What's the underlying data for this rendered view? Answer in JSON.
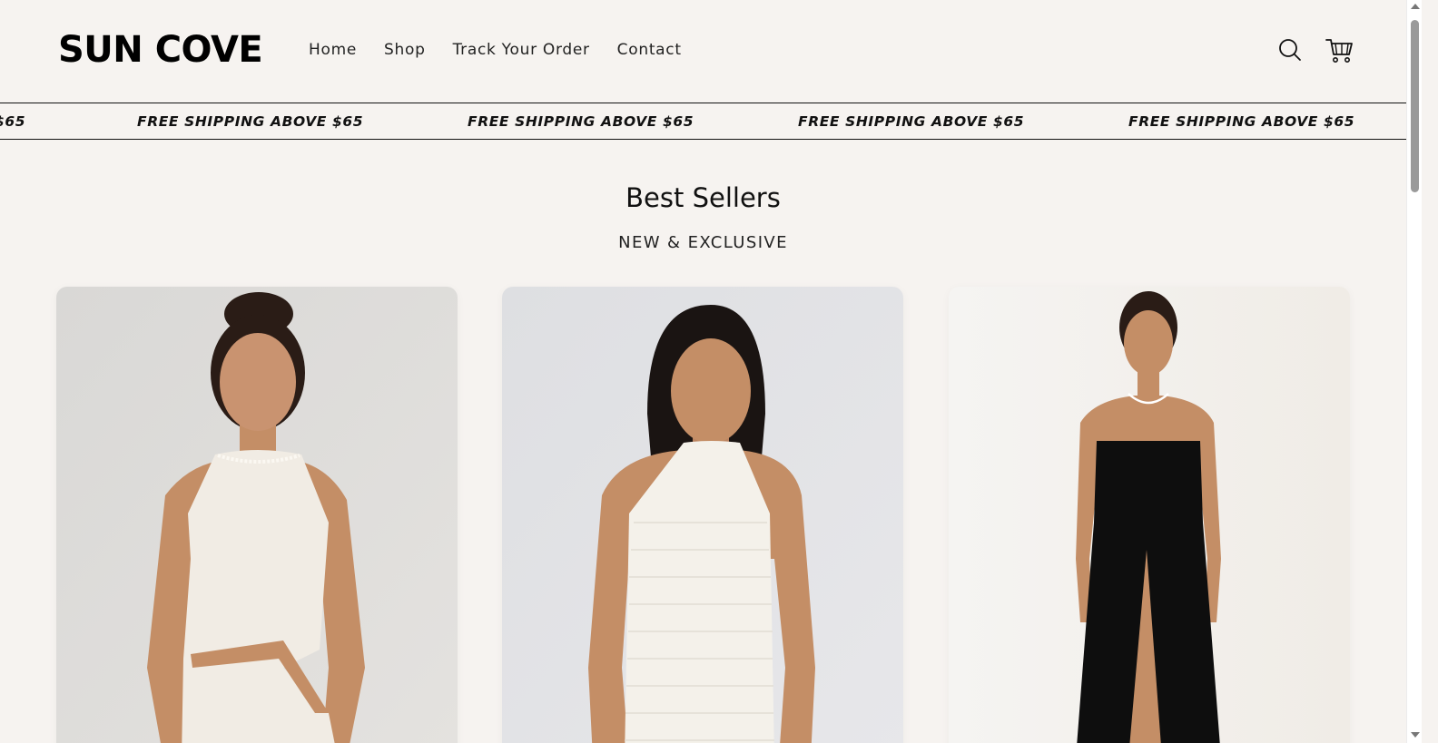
{
  "brand": {
    "logo_text": "SUN COVE"
  },
  "nav": {
    "items": [
      {
        "label": "Home"
      },
      {
        "label": "Shop"
      },
      {
        "label": "Track Your Order"
      },
      {
        "label": "Contact"
      }
    ]
  },
  "header_icons": {
    "search": "search-icon",
    "cart": "cart-icon"
  },
  "announcement": {
    "partial_left": "$65",
    "text": "FREE SHIPPING ABOVE $65"
  },
  "section": {
    "title": "Best Sellers",
    "subtitle": "NEW & EXCLUSIVE"
  },
  "products": [
    {
      "image": "model in white halter dress with cutout",
      "dress_color": "#f1ece4",
      "background": "#e3e1de"
    },
    {
      "image": "model in white textured halter dress",
      "dress_color": "#f4f1ea",
      "background": "#e6e6e8"
    },
    {
      "image": "model in black strapless gown with slit",
      "dress_color": "#0e0e0e",
      "background": "#f3f1ee"
    }
  ],
  "colors": {
    "page_background": "#f6f3f0",
    "text": "#111111",
    "skin": "#c48e66",
    "hair": "#2a1c16"
  }
}
